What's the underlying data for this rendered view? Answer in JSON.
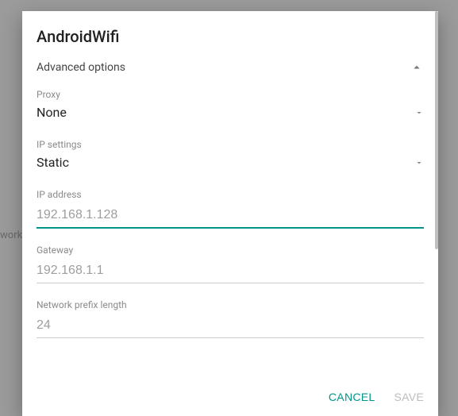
{
  "background": {
    "hint": "work"
  },
  "dialog": {
    "title": "AndroidWifi",
    "advanced_label": "Advanced options",
    "advanced_expanded": true,
    "proxy": {
      "label": "Proxy",
      "value": "None"
    },
    "ip_settings": {
      "label": "IP settings",
      "value": "Static"
    },
    "ip_address": {
      "label": "IP address",
      "placeholder": "192.168.1.128",
      "value": ""
    },
    "gateway": {
      "label": "Gateway",
      "placeholder": "192.168.1.1",
      "value": ""
    },
    "prefix_length": {
      "label": "Network prefix length",
      "placeholder": "24",
      "value": ""
    },
    "actions": {
      "cancel": "Cancel",
      "save": "Save"
    }
  }
}
